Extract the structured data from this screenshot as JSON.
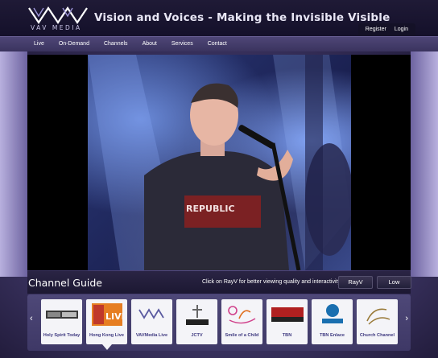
{
  "header": {
    "logo_text": "VAV MEDIA",
    "tagline": "Vision and Voices - Making the Invisible Visible",
    "account": {
      "register": "Register",
      "login": "Login"
    }
  },
  "nav": {
    "items": [
      {
        "label": "Live"
      },
      {
        "label": "On-Demand"
      },
      {
        "label": "Channels"
      },
      {
        "label": "About"
      },
      {
        "label": "Services"
      },
      {
        "label": "Contact"
      }
    ]
  },
  "video": {
    "shirt_text": "REPUBLIC"
  },
  "guide": {
    "title": "Channel Guide",
    "hint": "Click on RayV for better viewing quality and interactivity.:",
    "rayv_button": "RayV",
    "low_button": "Low"
  },
  "channels": [
    {
      "label": "Holy Spirit Today",
      "logo": "HOLY SPIRIT TODAY",
      "logo_color": "#444444"
    },
    {
      "label": "Hong Kong Live",
      "logo": "HONG KONG LIVE",
      "logo_color": "#e67e22"
    },
    {
      "label": "VAVMedia Live",
      "logo": "VAV",
      "logo_color": "#5a5aa0"
    },
    {
      "label": "JCTV",
      "logo": "JCTV",
      "logo_color": "#222222"
    },
    {
      "label": "Smile of a Child",
      "logo": "Smile of a Child",
      "logo_color": "#d0408a"
    },
    {
      "label": "TBN",
      "logo": "TBN",
      "logo_color": "#b02020"
    },
    {
      "label": "TBN Enlace",
      "logo": "enlace",
      "logo_color": "#1a6fb0"
    },
    {
      "label": "Church Channel",
      "logo": "The Church Channel",
      "logo_color": "#9a7b3a"
    }
  ],
  "colors": {
    "header_bg": "#1b1530",
    "nav_bg": "#4e4677",
    "accent": "#3f3a80"
  }
}
